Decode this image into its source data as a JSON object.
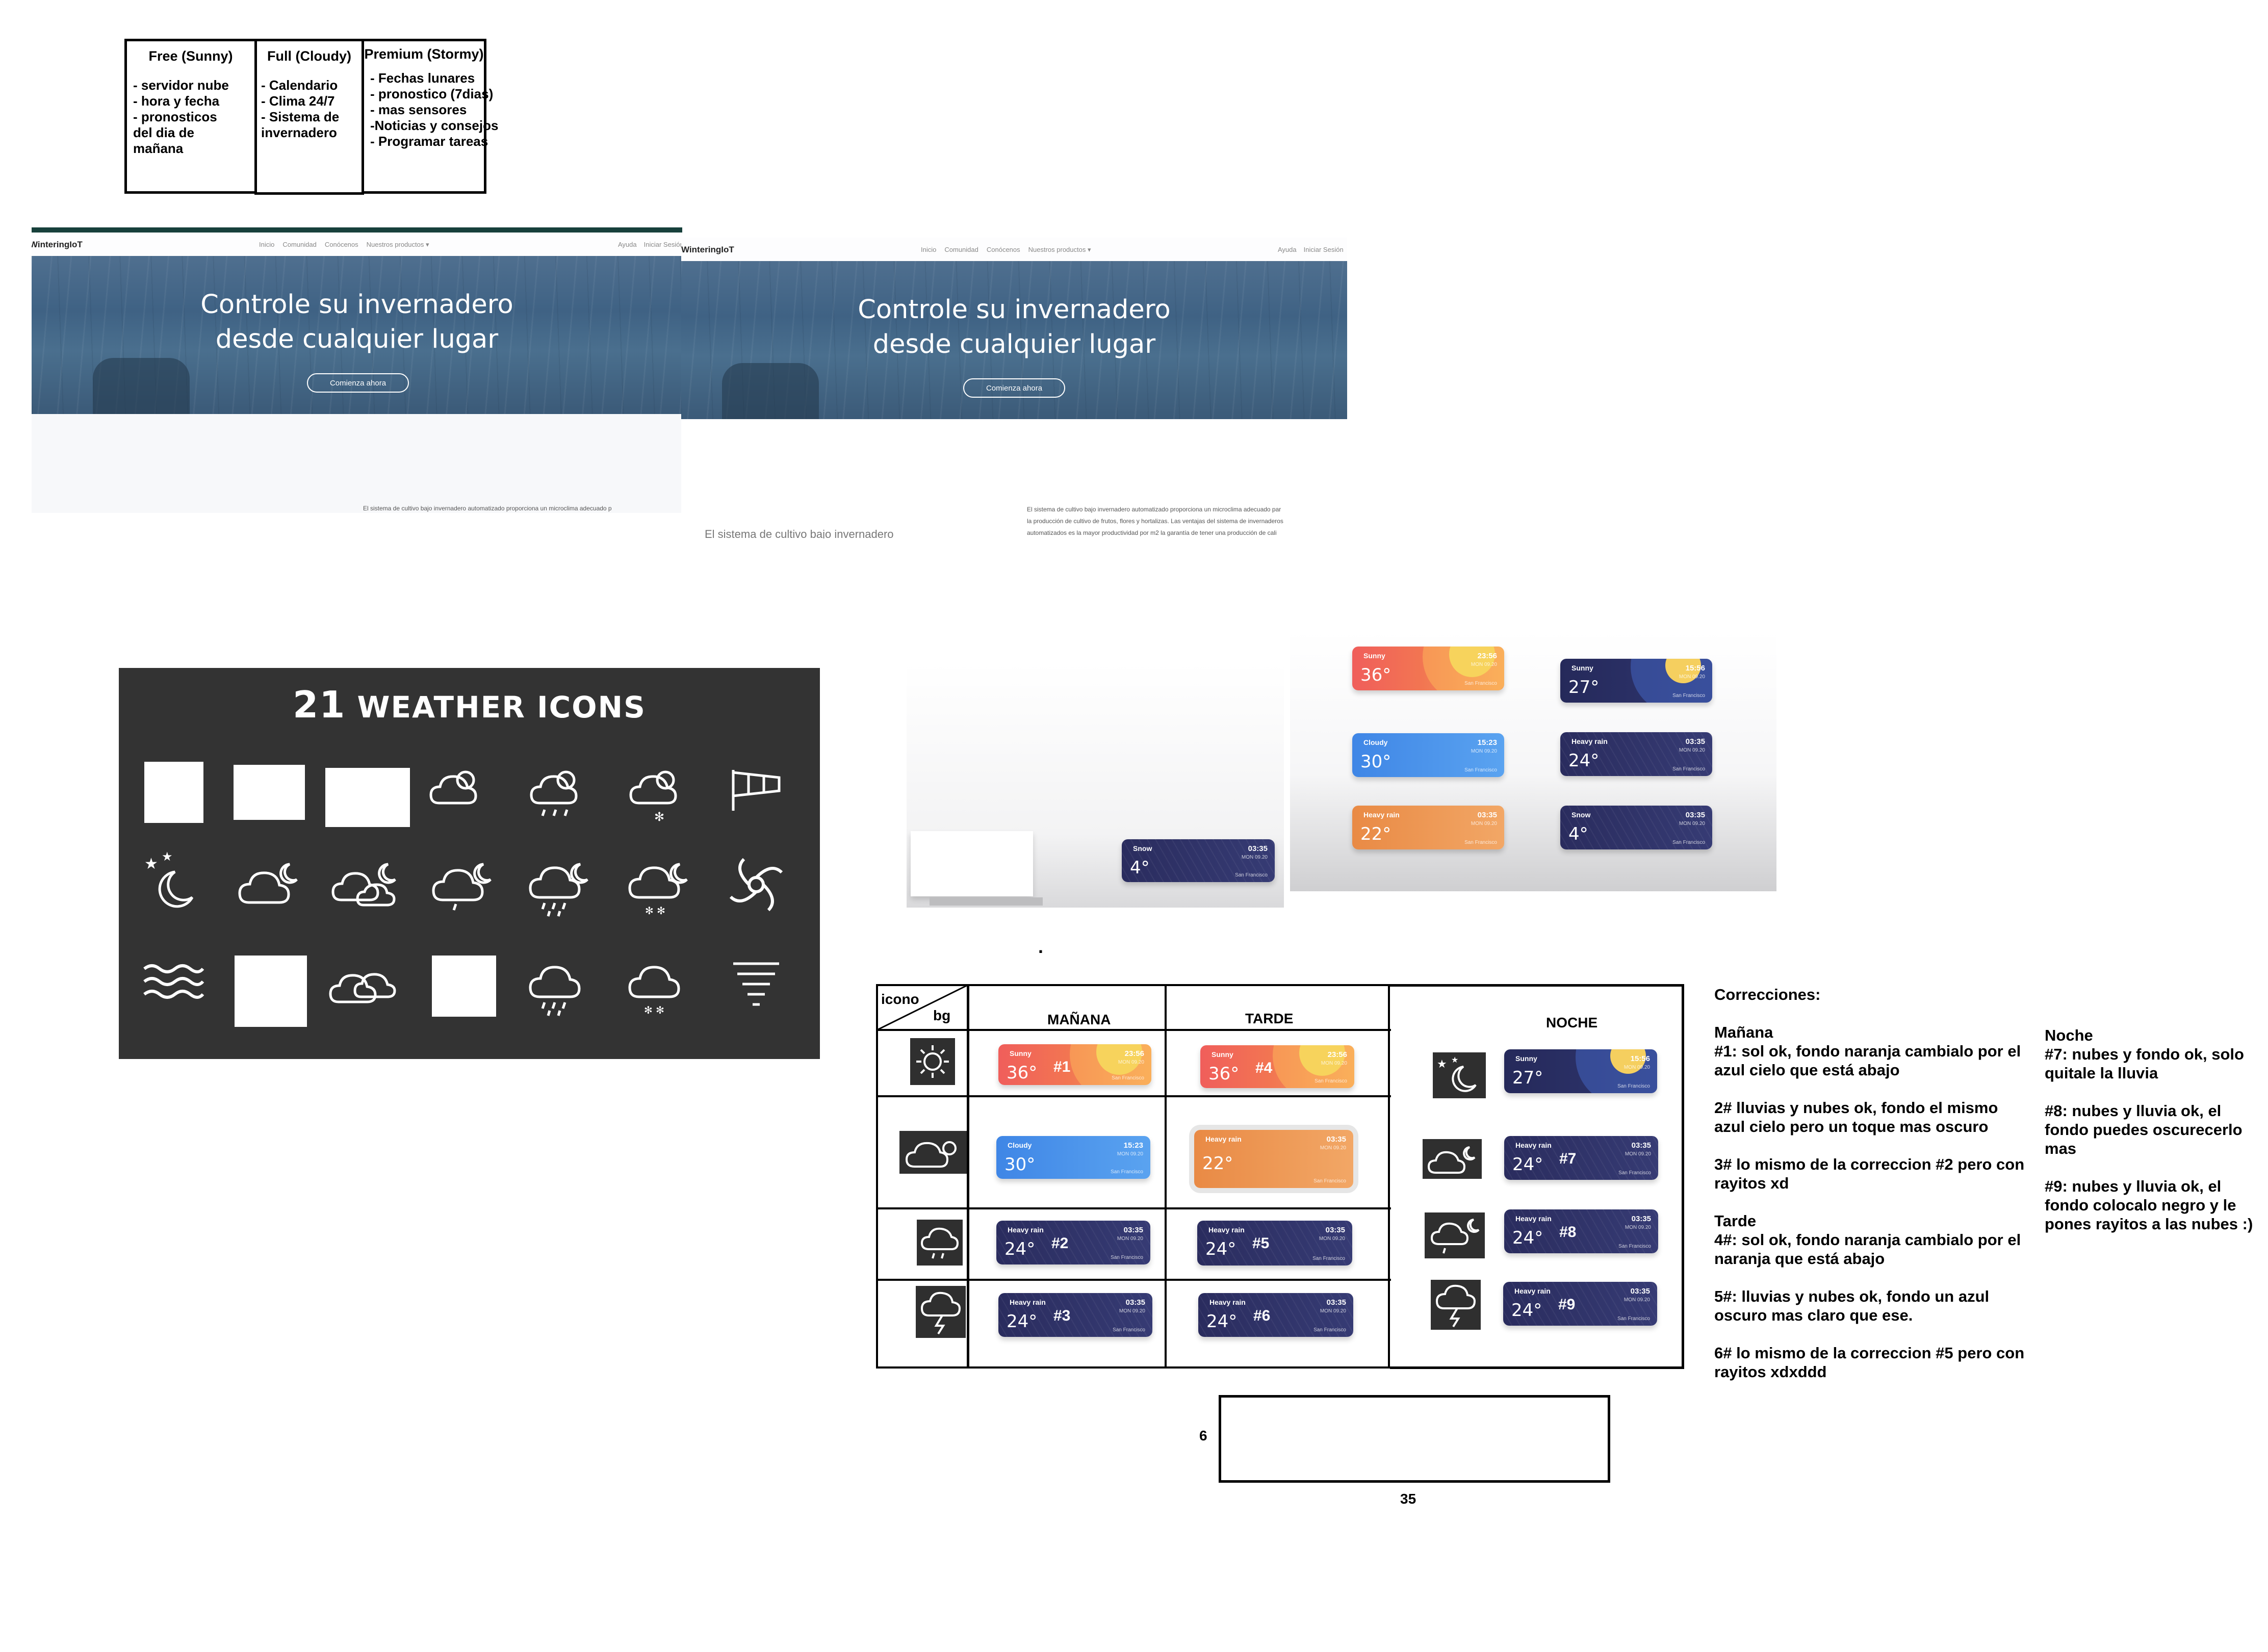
{
  "plans": [
    {
      "title": "Free (Sunny)",
      "items": [
        "- servidor nube",
        "- hora y fecha",
        "- pronosticos",
        "del dia de",
        "mañana"
      ]
    },
    {
      "title": "Full (Cloudy)",
      "items": [
        "- Calendario",
        "- Clima 24/7",
        "- Sistema de",
        "invernadero"
      ]
    },
    {
      "title": "Premium (Stormy)",
      "items": [
        "- Fechas lunares",
        "- pronostico (7dias)",
        "- mas sensores",
        "-Noticias y consejos",
        "- Programar tareas"
      ]
    }
  ],
  "site": {
    "brand": "WinteringIoT",
    "nav": [
      "Inicio",
      "Comunidad",
      "Conócenos",
      "Nuestros productos ▾"
    ],
    "right_nav": [
      "Ayuda",
      "Iniciar Sesión"
    ],
    "headline_1": "Controle su invernadero",
    "headline_2": "desde cualquier lugar",
    "cta": "Comienza ahora",
    "para_left": "El sistema de cultivo bajo invernadero automatizado proporciona un microclima adecuado p",
    "para_right_1": "El sistema de cultivo bajo invernadero automatizado proporciona un microclima adecuado par",
    "para_right_2": "la producción de cultivo de frutos, flores y hortalizas. Las ventajas del sistema de invernaderos",
    "para_right_3": "automatizados es la mayor productividad por m2 la garantía de tener una producción de cali",
    "para_cut": "El sistema de cultivo bajo invernadero"
  },
  "icon_sheet": {
    "number": "21",
    "title": "WEATHER ICONS"
  },
  "cards": {
    "sunny_day": {
      "cond": "Sunny",
      "temp": "36°",
      "time": "23:56",
      "date": "MON 09.20",
      "city": "San Francisco"
    },
    "sunny_night": {
      "cond": "Sunny",
      "temp": "27°",
      "time": "15:56",
      "date": "MON 09.20",
      "city": "San Francisco"
    },
    "cloudy": {
      "cond": "Cloudy",
      "temp": "30°",
      "time": "15:23",
      "date": "MON 09.20",
      "city": "San Francisco"
    },
    "heavy_rain": {
      "cond": "Heavy rain",
      "temp": "24°",
      "time": "03:35",
      "date": "MON 09.20",
      "city": "San Francisco"
    },
    "heavy_rain_orange": {
      "cond": "Heavy rain",
      "temp": "22°",
      "time": "03:35",
      "date": "MON 09.20",
      "city": "San Francisco"
    },
    "snow": {
      "cond": "Snow",
      "temp": "4°",
      "time": "03:35",
      "date": "MON 09.20",
      "city": "San Francisco"
    }
  },
  "grid": {
    "corner_top": "icono",
    "corner_bottom": "bg",
    "col_morning": "MAÑANA",
    "col_afternoon": "TARDE",
    "col_night": "NOCHE",
    "numbers": [
      "#1",
      "#2",
      "#3",
      "#4",
      "#5",
      "#6",
      "#7",
      "#8",
      "#9"
    ]
  },
  "dot": ".",
  "dimension_box": {
    "height_label": "6",
    "width_label": "35"
  },
  "corrections": {
    "title": "Correcciones:",
    "morning_head": "Mañana",
    "c1": "#1: sol ok, fondo naranja cambialo por el azul cielo que está abajo",
    "c2": "2# lluvias y nubes ok, fondo el mismo azul cielo pero un toque mas oscuro",
    "c3": "3# lo mismo de la correccion #2 pero con rayitos xd",
    "afternoon_head": "Tarde",
    "c4": "4#: sol ok, fondo naranja cambialo por el naranja que está abajo",
    "c5": "5#: lluvias y nubes ok, fondo un azul oscuro mas claro que ese.",
    "c6": "6# lo mismo de la correccion #5 pero con rayitos xdxddd",
    "night_head": "Noche",
    "c7": "#7: nubes y fondo ok, solo quitale la lluvia",
    "c8": "#8: nubes y lluvia ok, el fondo puedes oscurecerlo mas",
    "c9": "#9: nubes y lluvia ok, el fondo colocalo negro y le pones rayitos a las nubes :)"
  },
  "colors": {
    "sunny_bg": "#f05e5b",
    "sky_blue": "#3f86e6",
    "orange": "#e98a45",
    "navy": "#25295a",
    "icon_sheet_bg": "#333333"
  }
}
